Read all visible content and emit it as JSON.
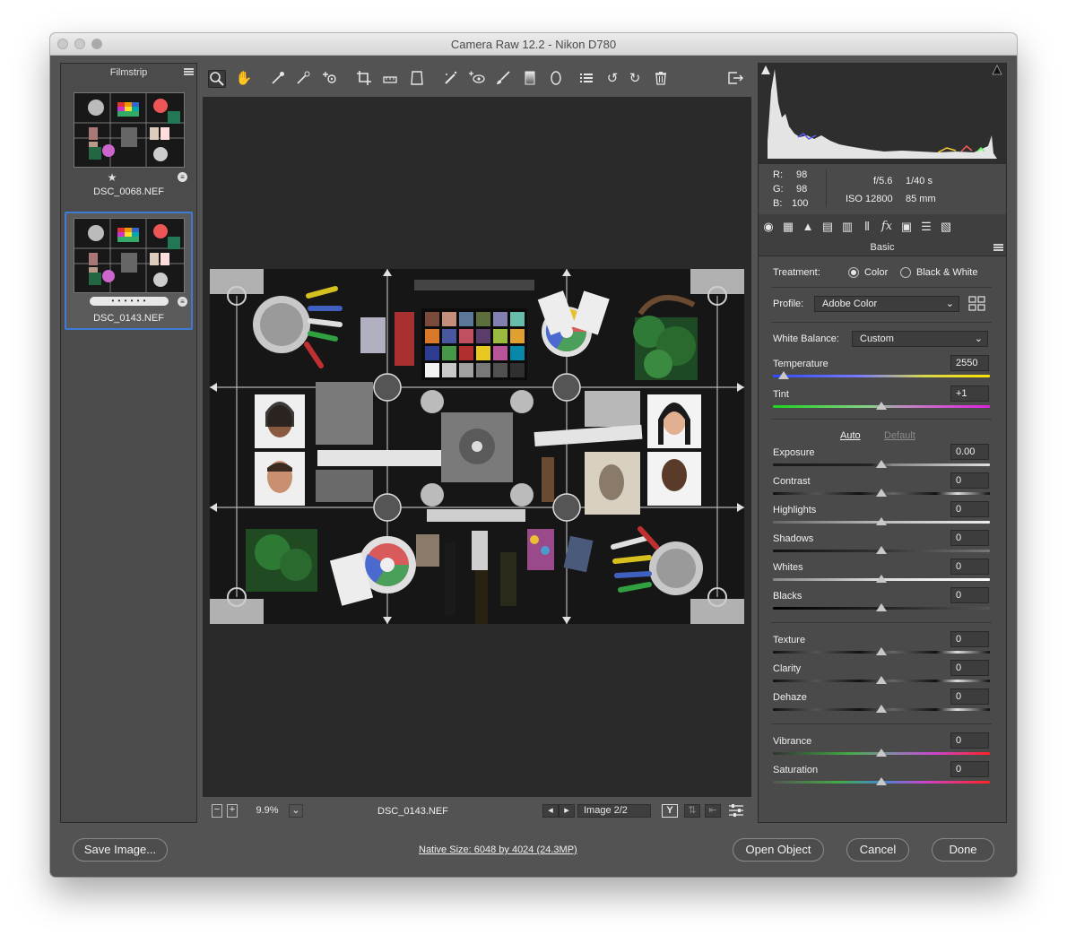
{
  "window": {
    "title": "Camera Raw 12.2  -  Nikon D780"
  },
  "filmstrip": {
    "title": "Filmstrip",
    "items": [
      {
        "name": "DSC_0068.NEF",
        "rating": "★"
      },
      {
        "name": "DSC_0143.NEF",
        "rating": "• • • • • •"
      }
    ]
  },
  "toolbar": {
    "tools": [
      "zoom-tool",
      "hand-tool",
      "white-balance-tool",
      "color-sampler-tool",
      "targeted-adjustment-tool",
      "crop-tool",
      "straighten-tool",
      "transform-tool",
      "spot-removal-tool",
      "red-eye-tool",
      "adjustment-brush",
      "graduated-filter",
      "radial-filter",
      "presets",
      "rotate-ccw",
      "rotate-cw",
      "trash"
    ]
  },
  "status": {
    "zoom": "9.9%",
    "filename": "DSC_0143.NEF",
    "image_counter": "Image 2/2",
    "yview_label": "Y"
  },
  "histogram": {
    "rgb": {
      "r_label": "R:",
      "r": "98",
      "g_label": "G:",
      "g": "98",
      "b_label": "B:",
      "b": "100"
    },
    "exif": {
      "aperture": "f/5.6",
      "shutter": "1/40 s",
      "iso": "ISO 12800",
      "focal": "85 mm"
    }
  },
  "panel": {
    "title": "Basic",
    "treatment": {
      "label": "Treatment:",
      "options": [
        "Color",
        "Black & White"
      ],
      "selected": "Color"
    },
    "profile": {
      "label": "Profile:",
      "value": "Adobe Color"
    },
    "white_balance": {
      "label": "White Balance:",
      "value": "Custom"
    },
    "temperature": {
      "label": "Temperature",
      "value": "2550",
      "position": 0.06
    },
    "tint": {
      "label": "Tint",
      "value": "+1",
      "position": 0.5
    },
    "auto_label": "Auto",
    "default_label": "Default",
    "tone": [
      {
        "label": "Exposure",
        "value": "0.00"
      },
      {
        "label": "Contrast",
        "value": "0"
      },
      {
        "label": "Highlights",
        "value": "0"
      },
      {
        "label": "Shadows",
        "value": "0"
      },
      {
        "label": "Whites",
        "value": "0"
      },
      {
        "label": "Blacks",
        "value": "0"
      }
    ],
    "presence": [
      {
        "label": "Texture",
        "value": "0"
      },
      {
        "label": "Clarity",
        "value": "0"
      },
      {
        "label": "Dehaze",
        "value": "0"
      }
    ],
    "color": [
      {
        "label": "Vibrance",
        "value": "0"
      },
      {
        "label": "Saturation",
        "value": "0"
      }
    ]
  },
  "footer": {
    "save": "Save Image...",
    "native_size": "Native Size: 6048 by 4024 (24.3MP)",
    "open": "Open Object",
    "cancel": "Cancel",
    "done": "Done"
  }
}
